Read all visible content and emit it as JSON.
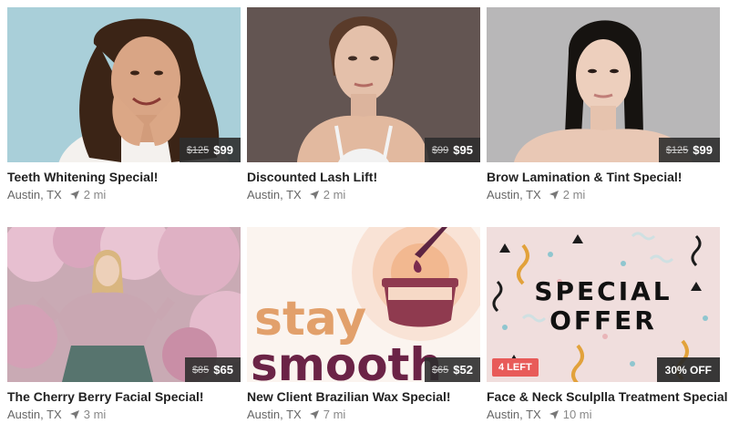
{
  "cards": [
    {
      "title": "Teeth Whitening Special!",
      "location": "Austin, TX",
      "distance": "2 mi",
      "price_old": "$125",
      "price_new": "$99"
    },
    {
      "title": "Discounted Lash Lift!",
      "location": "Austin, TX",
      "distance": "2 mi",
      "price_old": "$99",
      "price_new": "$95"
    },
    {
      "title": "Brow Lamination & Tint Special!",
      "location": "Austin, TX",
      "distance": "2 mi",
      "price_old": "$125",
      "price_new": "$99"
    },
    {
      "title": "The Cherry Berry Facial Special!",
      "location": "Austin, TX",
      "distance": "3 mi",
      "price_old": "$85",
      "price_new": "$65"
    },
    {
      "title": "New Client Brazilian Wax Special!",
      "location": "Austin, TX",
      "distance": "7 mi",
      "price_old": "$65",
      "price_new": "$52",
      "image_text_1": "stay",
      "image_text_2": "smooth"
    },
    {
      "title": "Face & Neck Sculplla Treatment Special",
      "location": "Austin, TX",
      "distance": "10 mi",
      "badge_left": "4 LEFT",
      "badge_right": "30% OFF",
      "image_text_1": "SPECIAL",
      "image_text_2": "OFFER"
    }
  ],
  "icons": {
    "location": "navigation-arrow-icon"
  }
}
